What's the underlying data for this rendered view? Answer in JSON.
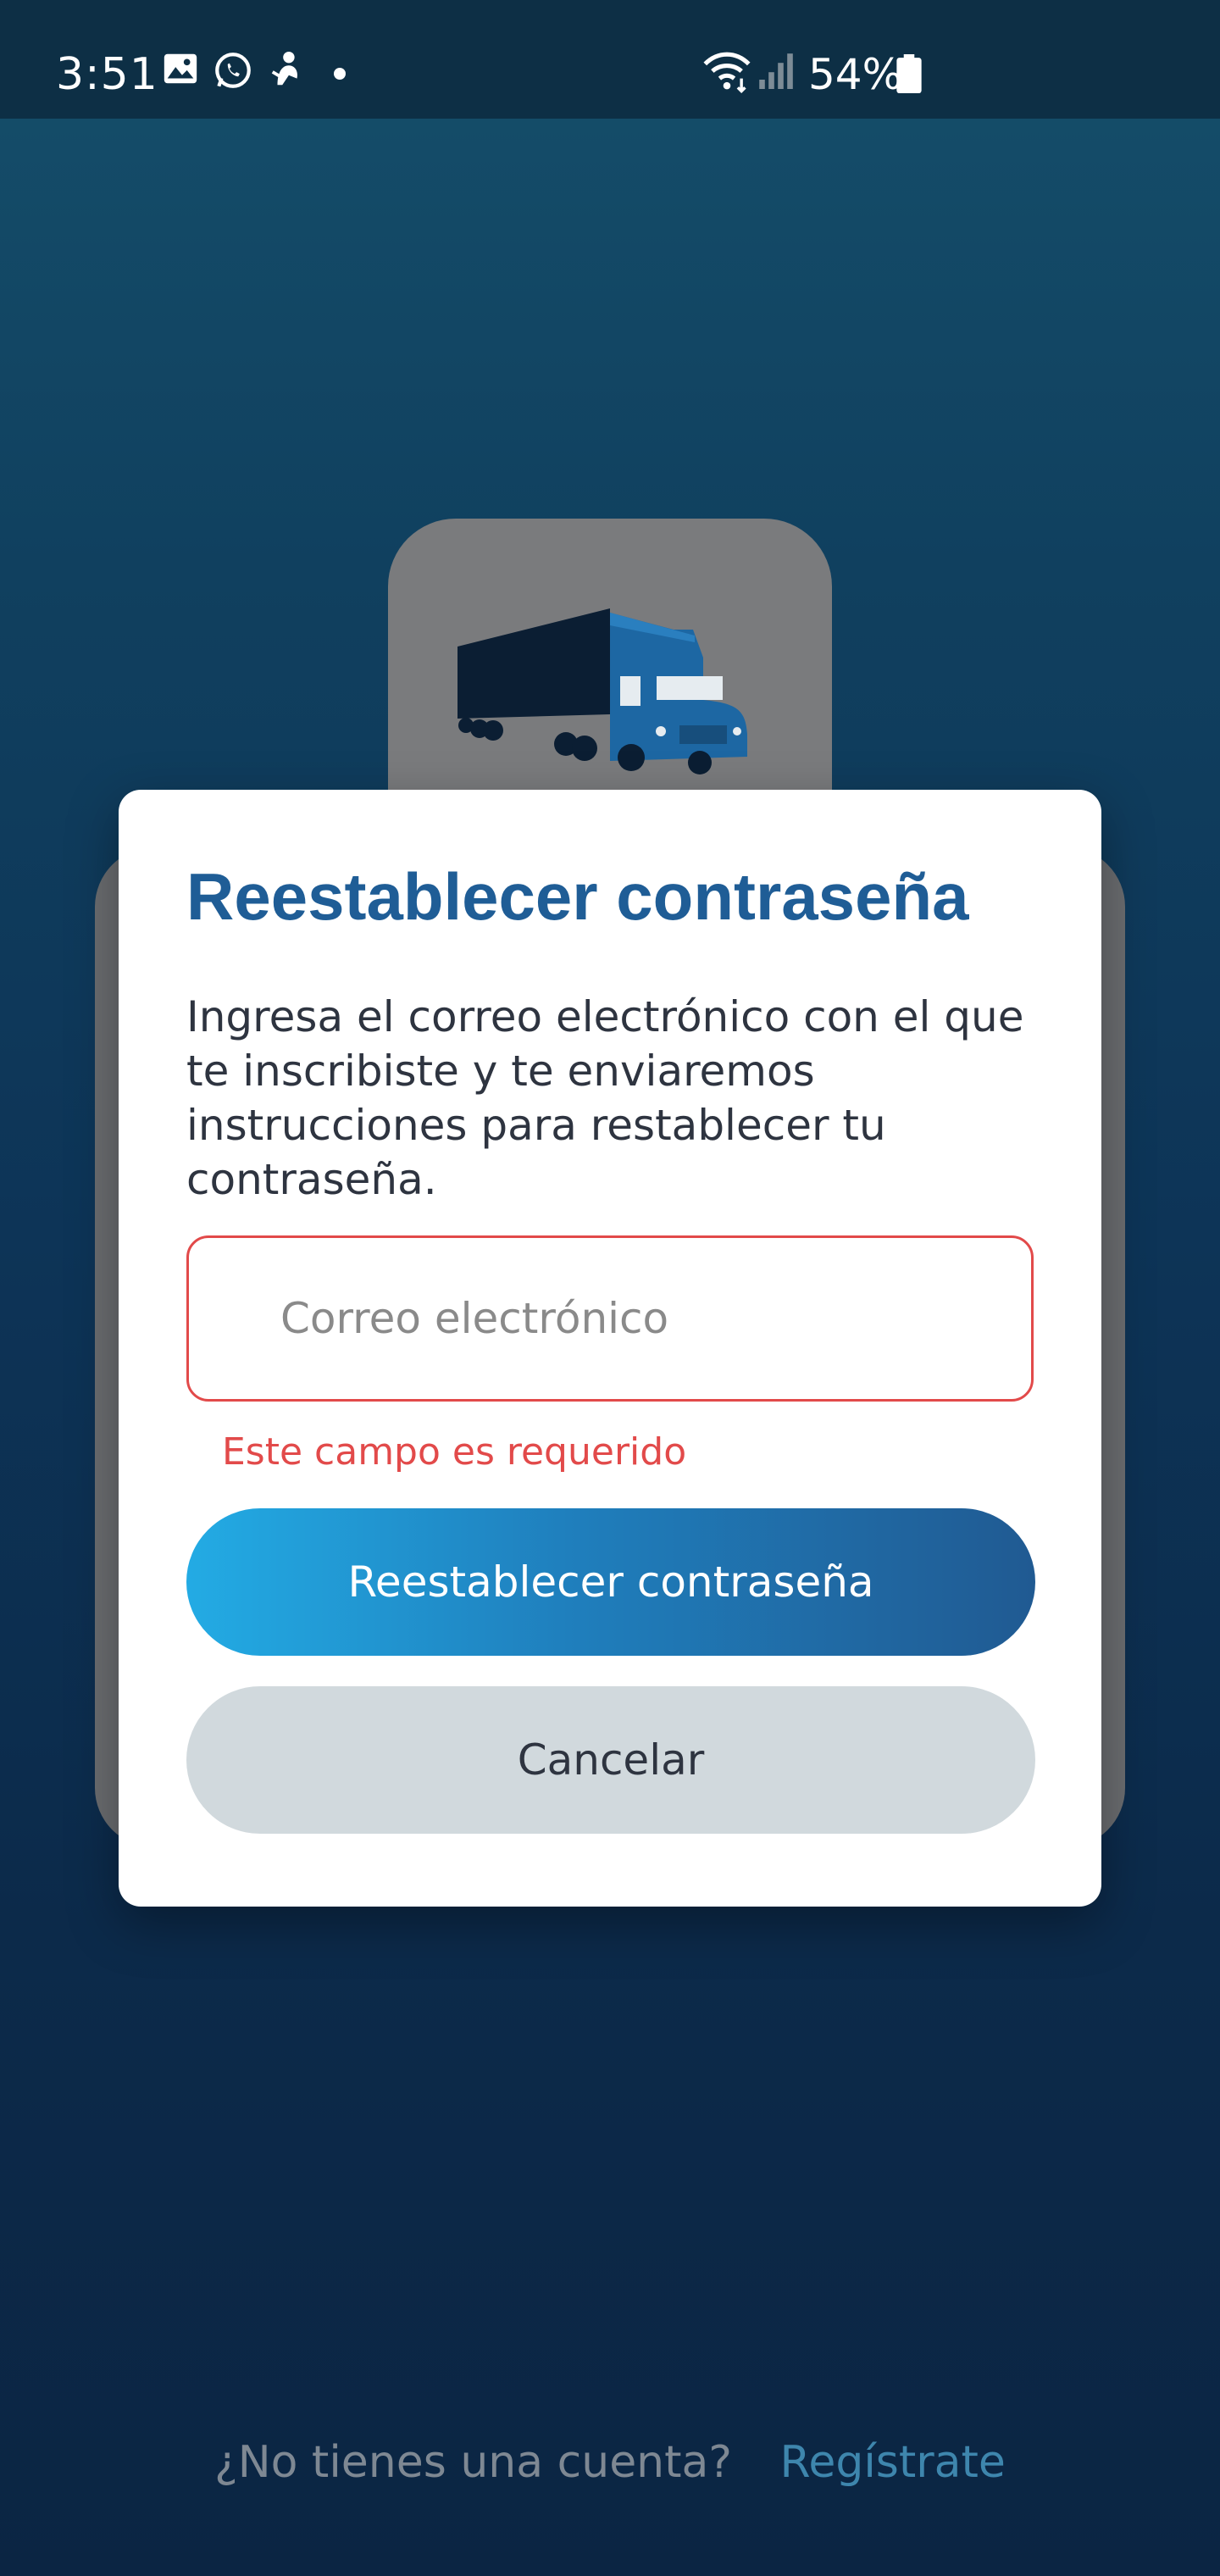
{
  "status_bar": {
    "time": "3:51",
    "notification_icons": [
      "image-icon",
      "whatsapp-icon",
      "app-notification-icon",
      "dot-icon"
    ],
    "system_icons": [
      "wifi-icon",
      "signal-icon",
      "battery-icon"
    ],
    "battery_percent": "54%"
  },
  "dialog": {
    "title": "Reestablecer contraseña",
    "description": "Ingresa el correo electrónico con el que te inscribiste y te enviaremos instrucciones para restablecer tu contraseña.",
    "email_placeholder": "Correo electrónico",
    "email_value": "",
    "error_message": "Este campo es requerido",
    "primary_button_label": "Reestablecer contraseña",
    "secondary_button_label": "Cancelar"
  },
  "background": {
    "logo_icon": "truck-icon"
  },
  "footer": {
    "question": "¿No tienes una cuenta?",
    "link_label": "Regístrate"
  },
  "colors": {
    "title": "#1f5d96",
    "error": "#e24a4a",
    "primary_gradient_start": "#23abe4",
    "primary_gradient_end": "#205a92",
    "secondary_button": "#d1d9dd",
    "link": "#3e86ad"
  }
}
